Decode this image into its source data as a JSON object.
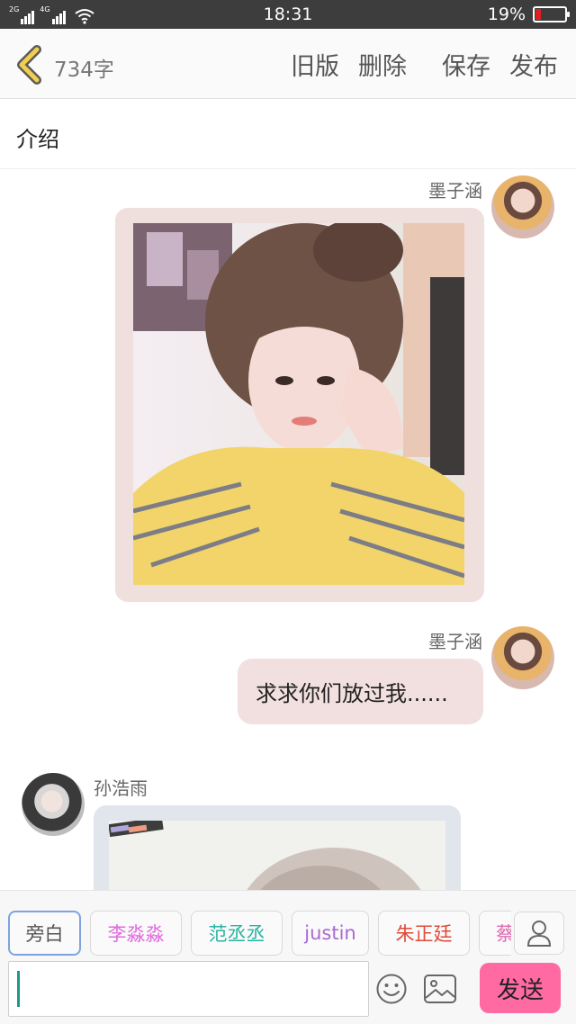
{
  "status_bar": {
    "network1_label": "2G",
    "network2_label": "4G",
    "time": "18:31",
    "battery_percent": "19%",
    "battery_level": 0.19,
    "battery_color": "#e02020"
  },
  "toolbar": {
    "back_icon": "chevron-left",
    "word_count": "734字",
    "old_version": "旧版",
    "delete": "删除",
    "save": "保存",
    "publish": "发布"
  },
  "intro": {
    "label": "介绍"
  },
  "messages": [
    {
      "sender": "墨子涵",
      "side": "right",
      "type": "image",
      "bubble_color": "#efdfdd"
    },
    {
      "sender": "墨子涵",
      "side": "right",
      "type": "text",
      "text": "求求你们放过我......",
      "bubble_color": "#f1e0df"
    },
    {
      "sender": "孙浩雨",
      "side": "left",
      "type": "image",
      "bubble_color": "#e1e6ec"
    }
  ],
  "characters": [
    {
      "name": "旁白",
      "color": "#555555",
      "active": true
    },
    {
      "name": "李淼淼",
      "color": "#e06ae0",
      "active": false
    },
    {
      "name": "范丞丞",
      "color": "#2bb3a3",
      "active": false
    },
    {
      "name": "justin",
      "color": "#a86ad4",
      "active": false
    },
    {
      "name": "朱正廷",
      "color": "#e04a3a",
      "active": false
    },
    {
      "name": "蔡",
      "color": "#e06ab0",
      "active": false
    }
  ],
  "input": {
    "value": "",
    "placeholder": ""
  },
  "send_button": {
    "label": "发送",
    "color": "#ff6aa2"
  },
  "accent_color": "#e8c84a"
}
